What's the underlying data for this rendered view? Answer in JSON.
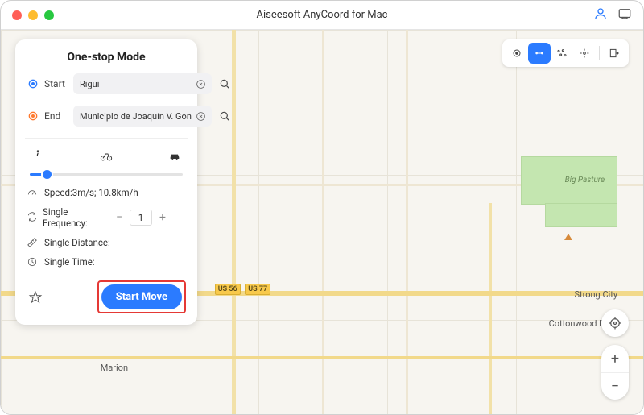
{
  "window": {
    "title": "Aiseesoft AnyCoord for Mac"
  },
  "panel": {
    "title": "One-stop Mode",
    "start_label": "Start",
    "start_value": "Rigui",
    "end_label": "End",
    "end_value": "Municipio de Joaquín V. Gon",
    "speed_text": "Speed:3m/s; 10.8km/h",
    "frequency_label": "Single Frequency:",
    "frequency_value": "1",
    "distance_label": "Single Distance:",
    "time_label": "Single Time:",
    "start_button": "Start Move"
  },
  "map": {
    "highway_shield_1": "US 56",
    "highway_shield_2": "US 77",
    "park_label": "Big Pasture",
    "city_marion": "Marion",
    "city_strong": "Strong City",
    "city_cottonwood": "Cottonwood Falls"
  }
}
